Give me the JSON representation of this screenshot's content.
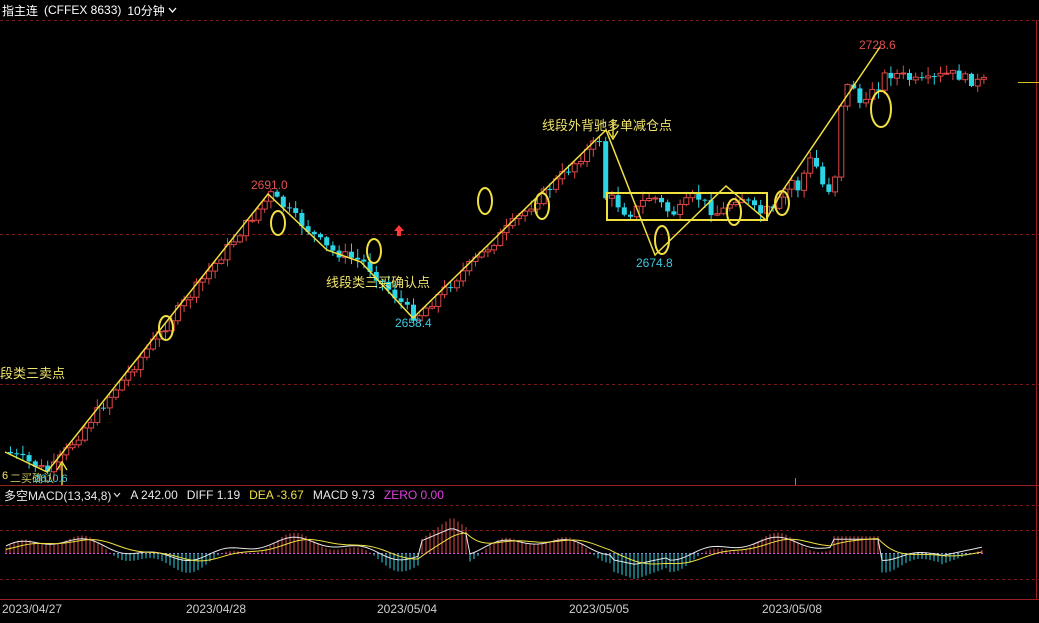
{
  "header": {
    "symbol": "指主连",
    "code": "(CFFEX 8633)",
    "timeframe": "10分钟"
  },
  "indicator": {
    "name": "多空MACD(13,34,8)",
    "a_text": "A 242.00",
    "diff_text": "DIFF 1.19",
    "dea_text": "DEA -3.67",
    "macd_text": "MACD 9.73",
    "zero_text": "ZERO 0.00"
  },
  "date_labels": [
    "2023/04/27",
    "2023/04/28",
    "2023/05/04",
    "2023/05/05",
    "2023/05/08"
  ],
  "annotations": {
    "left_cut": "段类三卖点",
    "bottom_left_cut": "二买确认",
    "segment_third_buy": "线段类三买确认点",
    "segment_divergence": "线段外背驰多单减仓点"
  },
  "price_labels": {
    "p2691": "2691.0",
    "p2658": "2658.4",
    "p2674": "2674.8",
    "p2728": "2728.6",
    "left_bottom": "2610.6",
    "left_side": "6"
  },
  "colors": {
    "background": "#000000",
    "up_candle": "#e04848",
    "down_candle": "#2ad6e6",
    "annotation": "#f0e46a",
    "zigzag": "#f0e040",
    "high_label": "#e05050",
    "low_label": "#40c8e0",
    "diff_line": "#e8e8e8",
    "dea_line": "#f0e040",
    "zero_line": "#e040e0"
  }
}
